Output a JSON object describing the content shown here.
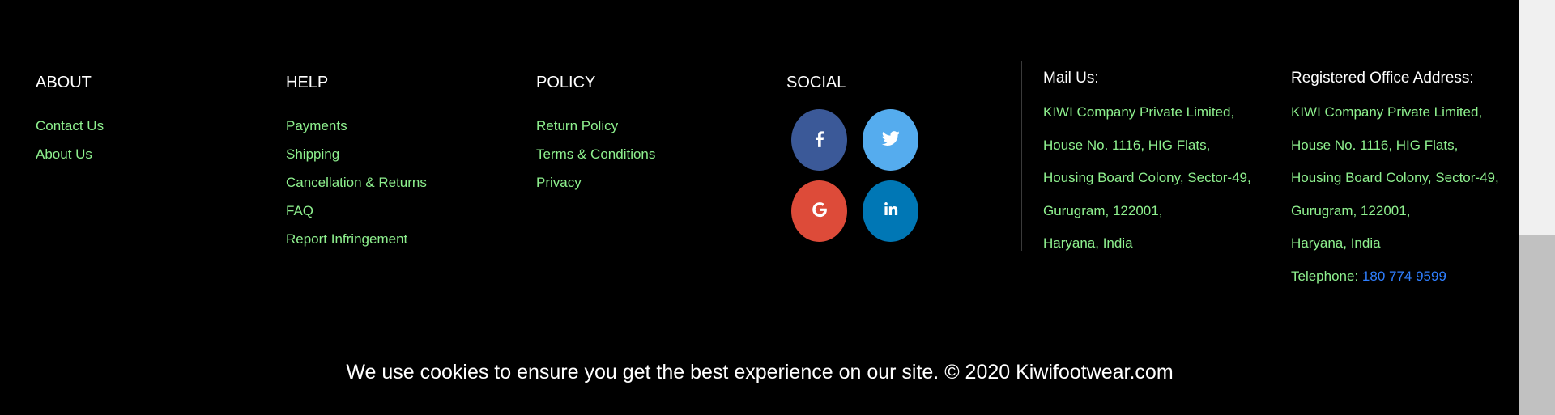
{
  "about": {
    "title": "ABOUT",
    "links": [
      "Contact Us",
      "About Us"
    ]
  },
  "help": {
    "title": "HELP",
    "links": [
      "Payments",
      "Shipping",
      "Cancellation & Returns",
      "FAQ",
      "Report Infringement"
    ]
  },
  "policy": {
    "title": "POLICY",
    "links": [
      "Return Policy",
      "Terms & Conditions",
      "Privacy"
    ]
  },
  "social": {
    "title": "SOCIAL",
    "buttons": [
      {
        "icon": "facebook-icon",
        "color": "#3b5998"
      },
      {
        "icon": "twitter-icon",
        "color": "#55acee"
      },
      {
        "icon": "google-icon",
        "color": "#dd4b39"
      },
      {
        "icon": "linkedin-icon",
        "color": "#0077b5"
      }
    ]
  },
  "mail": {
    "title": "Mail Us:",
    "lines": [
      "KIWI Company Private Limited,",
      "House No. 1116, HIG Flats,",
      "Housing Board Colony, Sector-49,",
      "Gurugram, 122001,",
      "Haryana, India"
    ]
  },
  "office": {
    "title": "Registered Office Address:",
    "lines": [
      "KIWI Company Private Limited,",
      "House No. 1116, HIG Flats,",
      "Housing Board Colony, Sector-49,",
      "Gurugram, 122001,",
      "Haryana, India"
    ],
    "telephone_label": "Telephone:",
    "telephone_number": "180 774 9599"
  },
  "bottom_text": "We use cookies to ensure you get the best experience on our site. © 2020 Kiwifootwear.com",
  "colors": {
    "background": "#000000",
    "link": "#8ef08e",
    "phone": "#2f7fff"
  }
}
